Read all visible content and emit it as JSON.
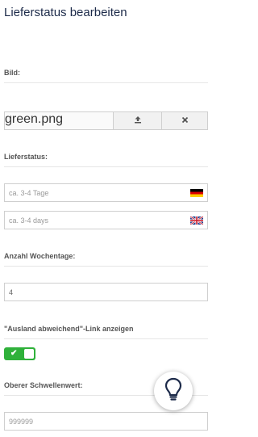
{
  "page": {
    "title": "Lieferstatus bearbeiten"
  },
  "image_section": {
    "label": "Bild:",
    "file_name": "green.png",
    "upload_icon": "upload-icon",
    "remove_icon": "close-icon"
  },
  "status_section": {
    "label": "Lieferstatus:",
    "inputs": [
      {
        "placeholder": "ca. 3-4 Tage",
        "flag": "de-flag-icon"
      },
      {
        "placeholder": "ca. 3-4 days",
        "flag": "uk-flag-icon"
      }
    ]
  },
  "weekdays_section": {
    "label": "Anzahl Wochentage:",
    "value": "4"
  },
  "abroad_link_section": {
    "label": "\"Ausland abweichend\"-Link anzeigen",
    "toggle_on": true,
    "toggle_color": "#2fb13a"
  },
  "threshold_section": {
    "label": "Oberer Schwellenwert:",
    "placeholder": "999999"
  },
  "help_button": {
    "icon": "lightbulb-icon"
  }
}
